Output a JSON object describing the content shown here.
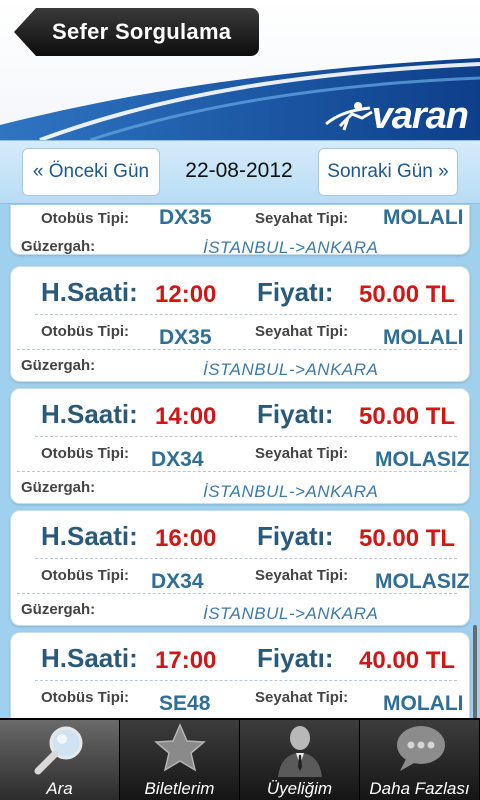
{
  "header": {
    "back_title": "Sefer Sorgulama",
    "brand": "varan"
  },
  "datebar": {
    "prev_label": "« Önceki Gün",
    "date": "22-08-2012",
    "next_label": "Sonraki Gün »"
  },
  "labels": {
    "time": "H.Saati:",
    "price": "Fiyatı:",
    "bus_type": "Otobüs Tipi:",
    "trip_type": "Seyahat Tipi:",
    "route": "Güzergah:"
  },
  "trips": [
    {
      "time": "",
      "price": "",
      "bus_type": "DX35",
      "trip_type": "MOLALI",
      "route": "İSTANBUL->ANKARA"
    },
    {
      "time": "12:00",
      "price": "50.00 TL",
      "bus_type": "DX35",
      "trip_type": "MOLALI",
      "route": "İSTANBUL->ANKARA"
    },
    {
      "time": "14:00",
      "price": "50.00 TL",
      "bus_type": "DX34",
      "trip_type": "MOLASIZ",
      "route": "İSTANBUL->ANKARA"
    },
    {
      "time": "16:00",
      "price": "50.00 TL",
      "bus_type": "DX34",
      "trip_type": "MOLASIZ",
      "route": "İSTANBUL->ANKARA"
    },
    {
      "time": "17:00",
      "price": "40.00 TL",
      "bus_type": "SE48",
      "trip_type": "MOLALI",
      "route": ""
    }
  ],
  "tabs": [
    {
      "label": "Ara",
      "icon": "magnifier-icon",
      "active": true
    },
    {
      "label": "Biletlerim",
      "icon": "star-icon",
      "active": false
    },
    {
      "label": "Üyeliğim",
      "icon": "user-icon",
      "active": false
    },
    {
      "label": "Daha Fazlası",
      "icon": "chat-bubble-icon",
      "active": false
    }
  ],
  "colors": {
    "price": "#d21515",
    "label": "#2a5a7a",
    "route": "#3f7ba6",
    "header_bg": "#1a5aa8"
  }
}
